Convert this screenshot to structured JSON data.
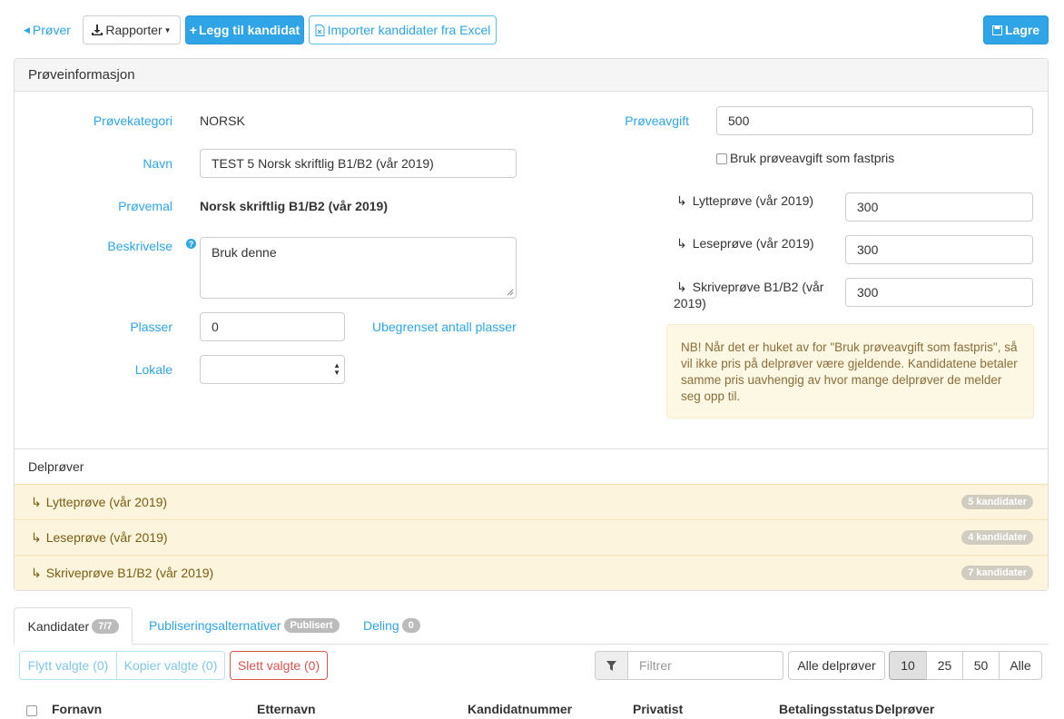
{
  "toolbar": {
    "back_label": "Prøver",
    "reports_label": "Rapporter",
    "add_candidate_label": "Legg til kandidat",
    "import_label": "Importer kandidater fra Excel",
    "save_label": "Lagre"
  },
  "panel": {
    "title": "Prøveinformasjon",
    "fields": {
      "category_label": "Prøvekategori",
      "category_value": "NORSK",
      "name_label": "Navn",
      "name_value": "TEST 5 Norsk skriftlig B1/B2 (vår 2019)",
      "template_label": "Prøvemal",
      "template_value": "Norsk skriftlig B1/B2 (vår 2019)",
      "description_label": "Beskrivelse",
      "description_value": "Bruk denne",
      "places_label": "Plasser",
      "places_value": "0",
      "unlimited_label": "Ubegrenset antall plasser",
      "location_label": "Lokale",
      "location_value": "",
      "fee_label": "Prøveavgift",
      "fee_value": "500",
      "fixed_price_label": "Bruk prøveavgift som fastpris",
      "sub_fees": [
        {
          "label": "Lytteprøve (vår 2019)",
          "value": "300"
        },
        {
          "label": "Leseprøve (vår 2019)",
          "value": "300"
        },
        {
          "label_line1": "Skriveprøve B1/B2 (vår",
          "label_line2": "2019)",
          "value": "300"
        }
      ],
      "notice": "NB! Når det er huket av for \"Bruk prøveavgift som fastpris\", så vil ikke pris på delprøver være gjeldende. Kandidatene betaler samme pris uavhengig av hvor mange delprøver de melder seg opp til."
    }
  },
  "subtests": {
    "heading": "Delprøver",
    "items": [
      {
        "name": "Lytteprøve (vår 2019)",
        "count": "5 kandidater"
      },
      {
        "name": "Leseprøve (vår 2019)",
        "count": "4 kandidater"
      },
      {
        "name": "Skriveprøve B1/B2 (vår 2019)",
        "count": "7 kandidater"
      }
    ]
  },
  "tabs": {
    "candidates_label": "Kandidater",
    "candidates_badge": "7/7",
    "publish_label": "Publiseringsalternativer",
    "publish_badge": "Publisert",
    "sharing_label": "Deling",
    "sharing_badge": "0"
  },
  "actions": {
    "move_label": "Flytt valgte (0)",
    "copy_label": "Kopier valgte (0)",
    "delete_label": "Slett valgte (0)",
    "filter_placeholder": "Filtrer",
    "all_subtests_label": "Alle delprøver",
    "page_sizes": [
      "10",
      "25",
      "50",
      "Alle"
    ]
  },
  "table": {
    "columns": [
      "Fornavn",
      "Etternavn",
      "Kandidatnummer",
      "Privatist",
      "Betalingsstatus",
      "Delprøver"
    ]
  }
}
